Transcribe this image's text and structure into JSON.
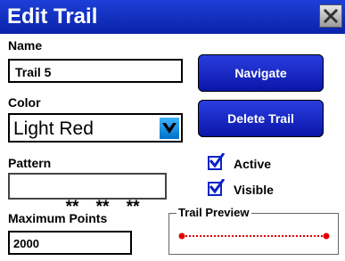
{
  "window": {
    "title": "Edit Trail"
  },
  "name": {
    "label": "Name",
    "value": "Trail 5"
  },
  "color": {
    "label": "Color",
    "value": "Light Red"
  },
  "pattern": {
    "label": "Pattern",
    "value": "** ** **"
  },
  "maximum_points": {
    "label": "Maximum Points",
    "value": "2000"
  },
  "buttons": {
    "navigate": "Navigate",
    "delete_trail": "Delete Trail"
  },
  "checkboxes": {
    "active": {
      "label": "Active",
      "checked": true
    },
    "visible": {
      "label": "Visible",
      "checked": true
    }
  },
  "trail_preview": {
    "label": "Trail Preview",
    "line_color": "#e00000"
  },
  "icons": {
    "close": "close-x-icon",
    "dropdown": "chevron-down-icon",
    "check": "checkmark-icon"
  }
}
